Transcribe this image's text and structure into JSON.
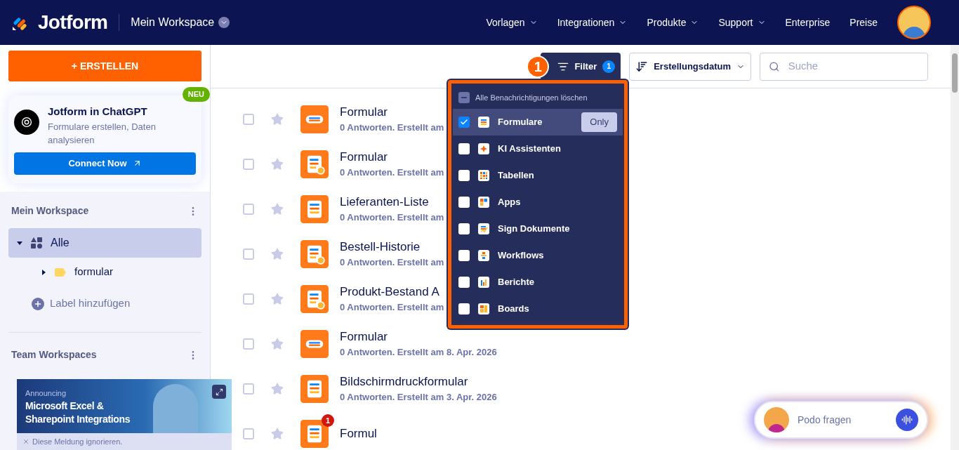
{
  "header": {
    "brand": "Jotform",
    "workspace": "Mein Workspace",
    "nav": [
      {
        "label": "Vorlagen",
        "dropdown": true
      },
      {
        "label": "Integrationen",
        "dropdown": true
      },
      {
        "label": "Produkte",
        "dropdown": true
      },
      {
        "label": "Support",
        "dropdown": true
      },
      {
        "label": "Enterprise",
        "dropdown": false
      },
      {
        "label": "Preise",
        "dropdown": false
      }
    ]
  },
  "sidebar": {
    "create_button": "+ ERSTELLEN",
    "promo": {
      "badge": "NEU",
      "title": "Jotform in ChatGPT",
      "text": "Formulare erstellen, Daten analysieren",
      "button": "Connect Now"
    },
    "sections": [
      {
        "title": "Mein Workspace",
        "items": [
          {
            "label": "Alle",
            "selected": true,
            "expanded": true,
            "kind": "all",
            "children": [
              {
                "label": "formular",
                "selected": false,
                "expanded": false,
                "kind": "label"
              }
            ]
          }
        ],
        "add_label": "Label hinzufügen"
      },
      {
        "title": "Team Workspaces"
      }
    ],
    "banner": {
      "kicker": "Announcing",
      "title": "Microsoft Excel & Sharepoint Integrations",
      "dismiss": "Diese Meldung ignorieren."
    }
  },
  "toolbar": {
    "annotation": "1",
    "filter": {
      "label": "Filter",
      "count": "1",
      "open": true
    },
    "sort": "Erstellungsdatum",
    "search": {
      "placeholder": "Suche"
    }
  },
  "filter_menu": {
    "clear_all": "Alle Benachrichtigungen löschen",
    "only_label": "Only",
    "items": [
      {
        "label": "Formulare",
        "kind": "forms",
        "checked": true,
        "highlighted": true
      },
      {
        "label": "KI Assistenten",
        "kind": "ai",
        "checked": false,
        "highlighted": false
      },
      {
        "label": "Tabellen",
        "kind": "tables",
        "checked": false,
        "highlighted": false
      },
      {
        "label": "Apps",
        "kind": "apps",
        "checked": false,
        "highlighted": false
      },
      {
        "label": "Sign Dokumente",
        "kind": "sign",
        "checked": false,
        "highlighted": false
      },
      {
        "label": "Workflows",
        "kind": "workflows",
        "checked": false,
        "highlighted": false
      },
      {
        "label": "Berichte",
        "kind": "reports",
        "checked": false,
        "highlighted": false
      },
      {
        "label": "Boards",
        "kind": "boards",
        "checked": false,
        "highlighted": false
      }
    ]
  },
  "forms": [
    {
      "title": "Formular",
      "meta": "0 Antworten. Erstellt am",
      "kind": "card",
      "checked": false,
      "starred": false
    },
    {
      "title": "Formular",
      "meta": "0 Antworten. Erstellt am",
      "kind": "payment",
      "checked": false,
      "starred": false
    },
    {
      "title": "Lieferanten-Liste",
      "meta": "0 Antworten. Erstellt am",
      "kind": "form",
      "checked": false,
      "starred": false
    },
    {
      "title": "Bestell-Historie",
      "meta": "0 Antworten. Erstellt am",
      "kind": "payment",
      "checked": false,
      "starred": false
    },
    {
      "title": "Produkt-Bestand A",
      "meta": "0 Antworten. Erstellt am",
      "kind": "payment",
      "checked": false,
      "starred": false
    },
    {
      "title": "Formular",
      "meta": "0 Antworten. Erstellt am 8. Apr. 2026",
      "kind": "card",
      "checked": false,
      "starred": false
    },
    {
      "title": "Bildschirmdruckformular",
      "meta": "0 Antworten. Erstellt am 3. Apr. 2026",
      "kind": "form",
      "checked": false,
      "starred": false
    },
    {
      "title": "Formul",
      "kind": "form",
      "checked": false,
      "starred": false,
      "badge": "1"
    }
  ],
  "assistant": {
    "placeholder": "Podo fragen"
  }
}
